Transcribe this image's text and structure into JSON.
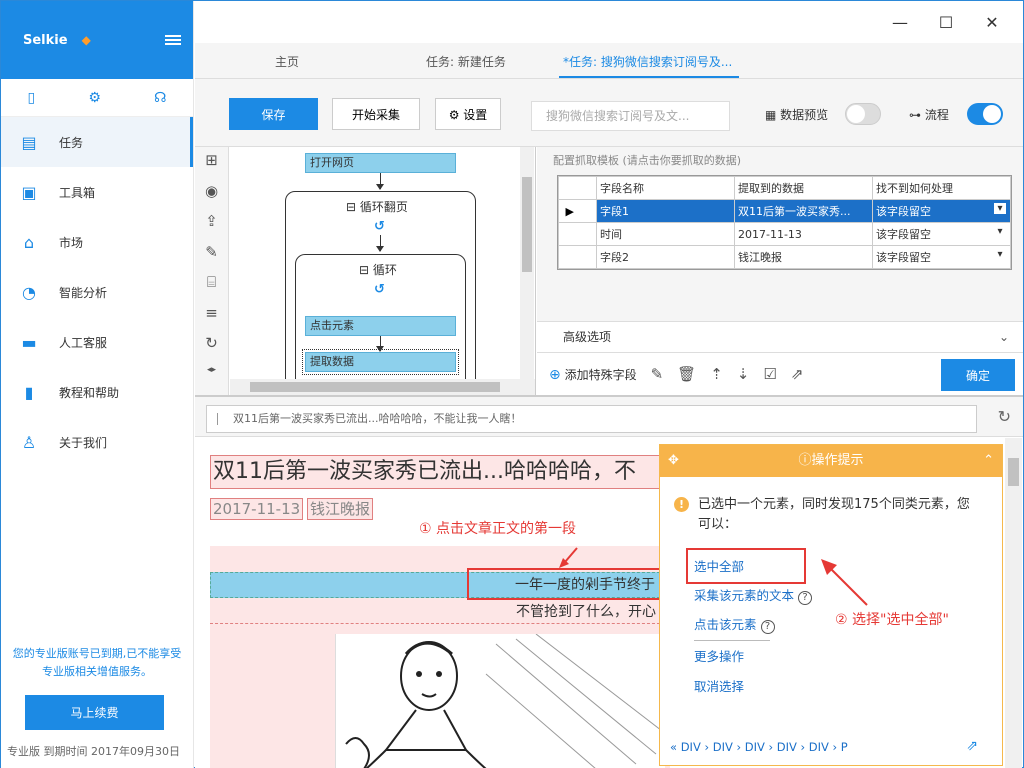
{
  "sidebar": {
    "brand": "Selkie",
    "nav": [
      {
        "label": "任务",
        "icon": "task-icon",
        "glyph": "▤"
      },
      {
        "label": "工具箱",
        "icon": "toolbox-icon",
        "glyph": "▣"
      },
      {
        "label": "市场",
        "icon": "store-icon",
        "glyph": "⌂"
      },
      {
        "label": "智能分析",
        "icon": "pie-chart-icon",
        "glyph": "◔"
      },
      {
        "label": "人工客服",
        "icon": "chat-icon",
        "glyph": "▬"
      },
      {
        "label": "教程和帮助",
        "icon": "book-icon",
        "glyph": "▮"
      },
      {
        "label": "关于我们",
        "icon": "user-icon",
        "glyph": "♙"
      }
    ],
    "notice": "您的专业版账号已到期,已不能享受专业版相关增值服务。",
    "renew_label": "马上续费",
    "footer": "专业版  到期时间 2017年09月30日"
  },
  "tabs": [
    "主页",
    "任务: 新建任务",
    "*任务: 搜狗微信搜索订阅号及..."
  ],
  "toolbar": {
    "save": "保存",
    "start": "开始采集",
    "settings": "设置",
    "search_placeholder": "搜狗微信搜索订阅号及文...",
    "preview_label": "数据预览",
    "flow_label": "流程"
  },
  "flow": {
    "open_page": "打开网页",
    "loop_page": "循环翻页",
    "loop": "循环",
    "click_el": "点击元素",
    "extract": "提取数据"
  },
  "config": {
    "title": "配置抓取模板 (请点击你要抓取的数据)",
    "headers": [
      "字段名称",
      "提取到的数据",
      "找不到如何处理"
    ],
    "rows": [
      {
        "name": "字段1",
        "value": "双11后第一波买家秀...",
        "handle": "该字段留空"
      },
      {
        "name": "时间",
        "value": "2017-11-13",
        "handle": "该字段留空"
      },
      {
        "name": "字段2",
        "value": "钱江晚报",
        "handle": "该字段留空"
      }
    ],
    "advanced": "高级选项",
    "add_field": "添加特殊字段",
    "ok": "确定"
  },
  "url": "双11后第一波买家秀已流出...哈哈哈哈，不能让我一人瞎！",
  "page": {
    "title": "双11后第一波买家秀已流出...哈哈哈哈，不",
    "date": "2017-11-13",
    "source": "钱江晚报",
    "para1": "一年一度的剁手节终于",
    "para2": "不管抢到了什么，开心"
  },
  "annotations": {
    "step1": "① 点击文章正文的第一段",
    "step2": "② 选择\"选中全部\""
  },
  "tip": {
    "title": "操作提示",
    "message": "已选中一个元素，同时发现175个同类元素，您可以：",
    "select_all": "选中全部",
    "collect_text": "采集该元素的文本",
    "click_element": "点击该元素",
    "more": "更多操作",
    "cancel": "取消选择",
    "path": "«  DIV  ›  DIV  ›  DIV  ›  DIV  ›  DIV  ›  P"
  },
  "colors": {
    "accent": "#1c8ae4",
    "tip": "#f7b44a",
    "annotation": "#e53935"
  }
}
